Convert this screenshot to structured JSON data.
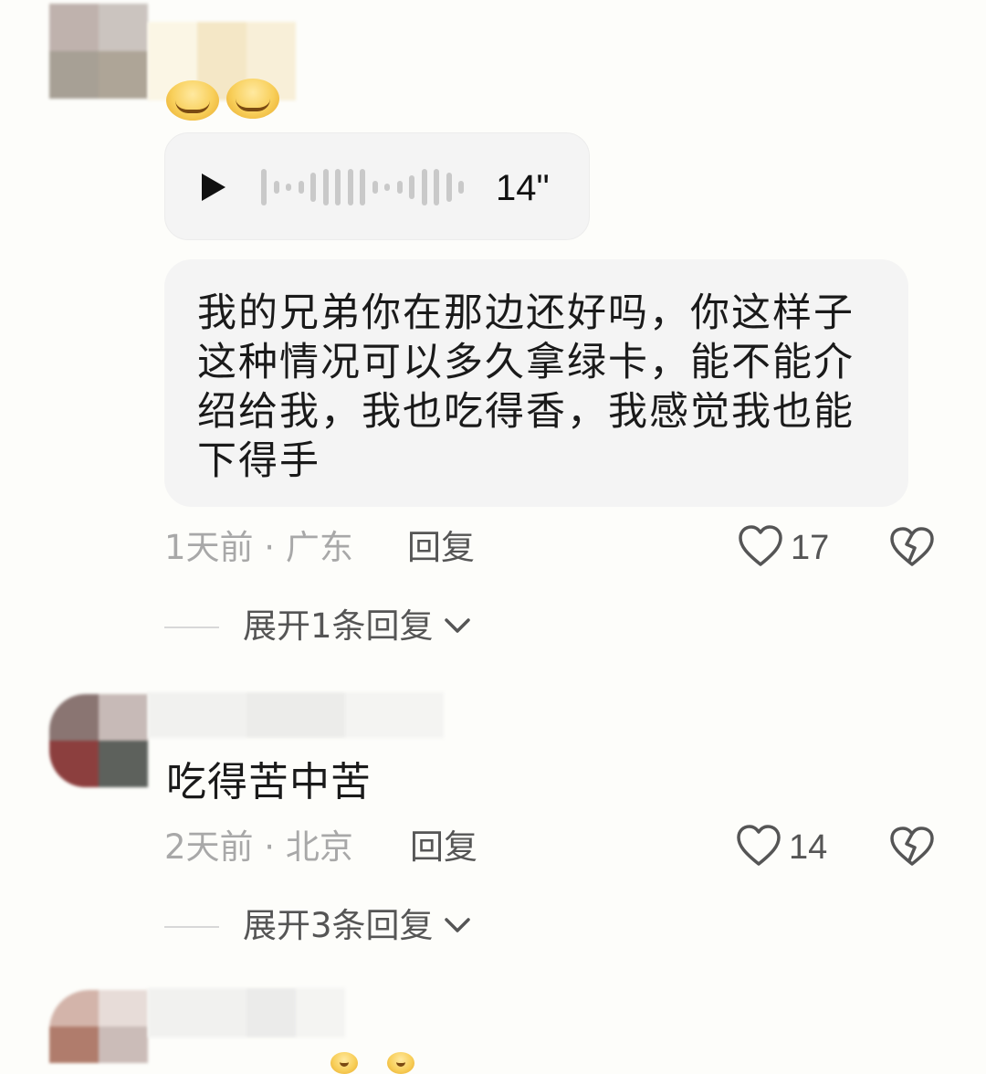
{
  "comments": [
    {
      "voice": {
        "duration": "14\""
      },
      "text": "我的兄弟你在那边还好吗，你这样子这种情况可以多久拿绿卡，能不能介绍给我，我也吃得香，我感觉我也能下得手",
      "time_location": "1天前 · 广东",
      "reply_label": "回复",
      "likes": "17",
      "expand_label": "展开1条回复"
    },
    {
      "text": "吃得苦中苦",
      "time_location": "2天前 · 北京",
      "reply_label": "回复",
      "likes": "14",
      "expand_label": "展开3条回复"
    }
  ],
  "icons": [
    "play-icon",
    "heart-icon",
    "broken-heart-icon",
    "chevron-down-icon"
  ],
  "colors": {
    "background": "#fdfdfa",
    "bubble": "#f4f4f4",
    "muted_text": "#a8a8a8",
    "icon": "#555555"
  }
}
